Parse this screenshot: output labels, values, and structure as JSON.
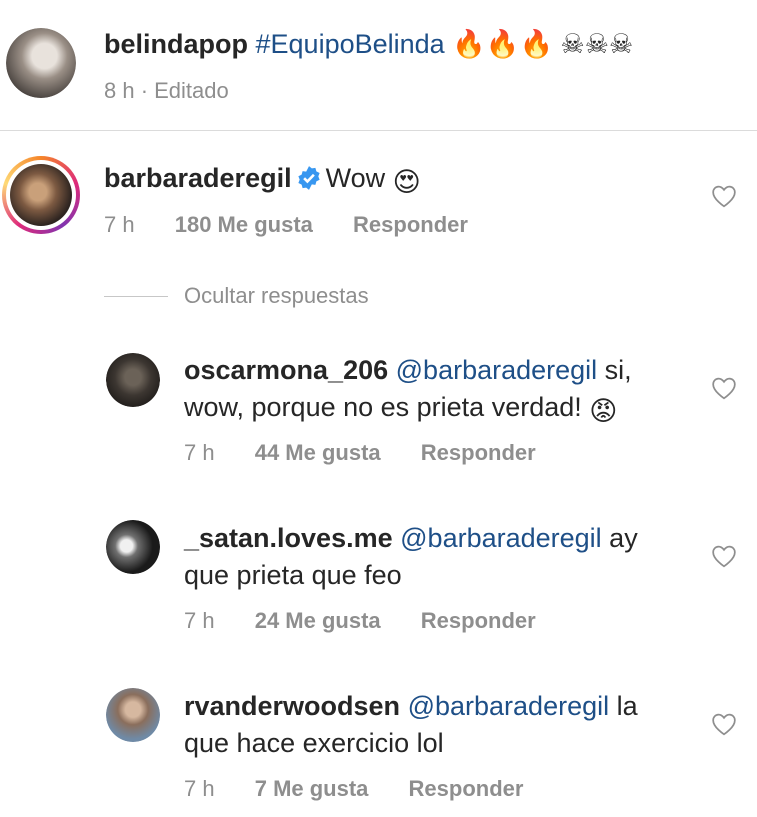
{
  "caption": {
    "username": "belindapop",
    "hashtag": "#EquipoBelinda",
    "emojis": "🔥🔥🔥 ☠☠☠",
    "time": "8 h · Editado"
  },
  "comment": {
    "username": "barbaraderegil",
    "text": "Wow",
    "emoji": "😍",
    "time": "7 h",
    "likes": "180 Me gusta",
    "reply": "Responder",
    "hide_replies": "Ocultar respuestas"
  },
  "replies": [
    {
      "username": "oscarmona_206",
      "mention": "@barbaraderegil",
      "text1": " si,",
      "text2": "wow, porque no es prieta verdad!",
      "emoji": "😡",
      "time": "7 h",
      "likes": "44 Me gusta",
      "reply": "Responder"
    },
    {
      "username": "_satan.loves.me",
      "mention": "@barbaraderegil",
      "text1": " ay",
      "text2": "que prieta que feo",
      "time": "7 h",
      "likes": "24 Me gusta",
      "reply": "Responder"
    },
    {
      "username": "rvanderwoodsen",
      "mention": "@barbaraderegil",
      "text1": " la",
      "text2": "que hace exercicio lol",
      "time": "7 h",
      "likes": "7 Me gusta",
      "reply": "Responder"
    }
  ],
  "icons": {
    "like": "heart-icon",
    "verified": "verified-badge-icon"
  },
  "colors": {
    "mention": "#1e4f87",
    "meta": "#8e8e8e",
    "verified": "#3897f0"
  }
}
